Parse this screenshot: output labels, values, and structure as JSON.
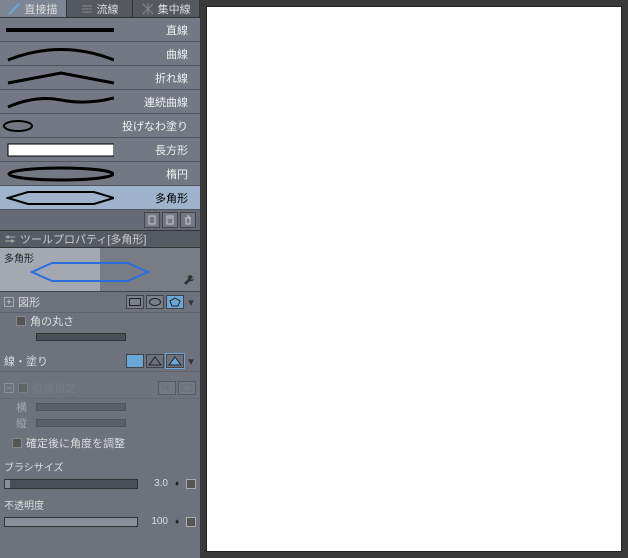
{
  "modeTabs": [
    {
      "label": "直接描",
      "active": true
    },
    {
      "label": "流線",
      "active": false
    },
    {
      "label": "集中線",
      "active": false
    }
  ],
  "shapes": [
    {
      "id": "line",
      "label": "直線",
      "selected": false
    },
    {
      "id": "curve",
      "label": "曲線",
      "selected": false
    },
    {
      "id": "polyline",
      "label": "折れ線",
      "selected": false
    },
    {
      "id": "ccurve",
      "label": "連続曲線",
      "selected": false
    },
    {
      "id": "lasso",
      "label": "投げなわ塗り",
      "selected": false
    },
    {
      "id": "rect",
      "label": "長方形",
      "selected": false
    },
    {
      "id": "ellipse",
      "label": "楕円",
      "selected": false
    },
    {
      "id": "polygon",
      "label": "多角形",
      "selected": true
    }
  ],
  "sectionHeader": "ツールプロパティ[多角形]",
  "polyBlock": {
    "title": "多角形"
  },
  "figureRow": {
    "label": "図形"
  },
  "cornerRow": {
    "label": "角の丸さ"
  },
  "fillRow": {
    "label": "線・塗り"
  },
  "aspectRow": {
    "label": "縦横指定"
  },
  "aspectH": "横",
  "aspectV": "縦",
  "angleRow": {
    "label": "確定後に角度を調整"
  },
  "brushSize": {
    "label": "ブラシサイズ",
    "value": "3.0",
    "pct": 4
  },
  "opacity": {
    "label": "不透明度",
    "value": "100",
    "pct": 100
  }
}
